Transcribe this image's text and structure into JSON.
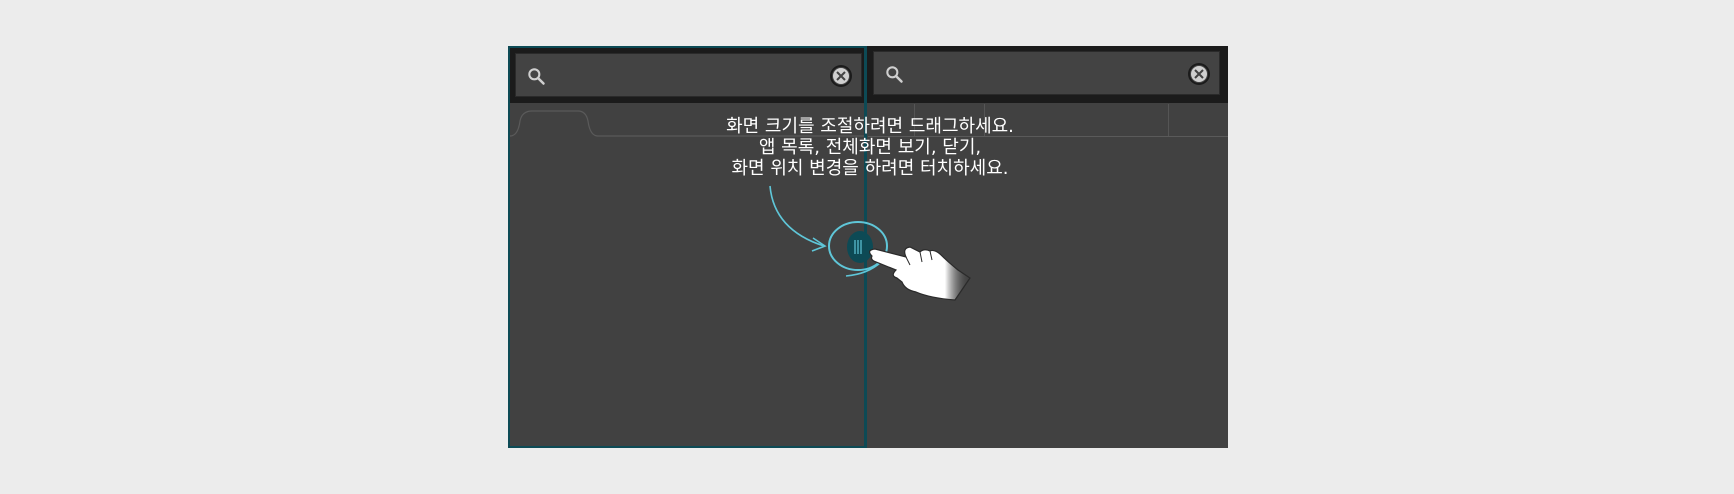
{
  "instructions": {
    "line1": "화면 크기를 조절하려면 드래그하세요.",
    "line2": "앱 목록, 전체화면 보기, 닫기,",
    "line3": "화면 위치 변경을 하려면 터치하세요."
  },
  "colors": {
    "page_background": "#ececec",
    "panel_background": "#414141",
    "top_bar": "#1b1b1b",
    "focus_border": "#0d4a55",
    "accent": "#5fc6d8",
    "text": "#ffffff"
  },
  "icons": {
    "left_search": "search-icon",
    "left_clear": "clear-icon",
    "right_search": "search-icon",
    "right_clear": "clear-icon",
    "handle": "split-handle-icon",
    "hand": "pointing-hand-icon",
    "arrow": "curved-arrow-icon"
  }
}
